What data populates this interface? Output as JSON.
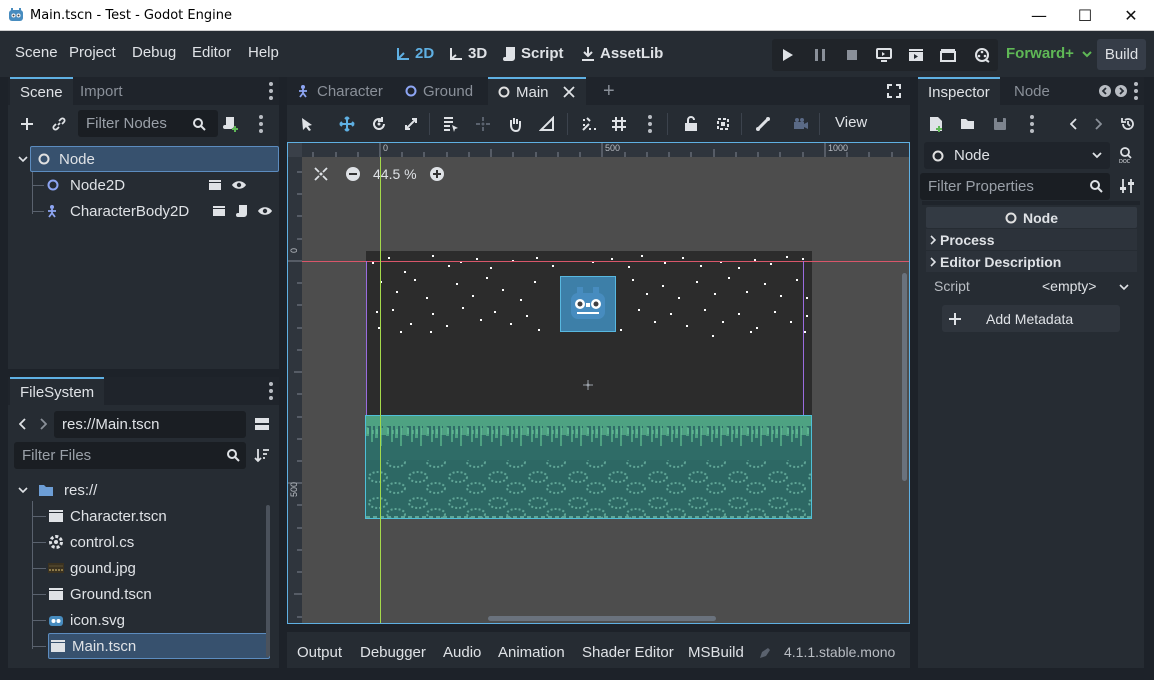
{
  "window": {
    "title": "Main.tscn - Test - Godot Engine",
    "minimize": "—",
    "maximize": "☐",
    "close": "✕"
  },
  "menubar": {
    "menus": [
      "Scene",
      "Project",
      "Debug",
      "Editor",
      "Help"
    ],
    "workspaces": [
      "2D",
      "3D",
      "Script",
      "AssetLib"
    ],
    "renderer": "Forward+",
    "build": "Build"
  },
  "scene_dock": {
    "tabs": [
      "Scene",
      "Import"
    ],
    "filter_placeholder": "Filter Nodes",
    "nodes": [
      {
        "name": "Node",
        "type": "Node",
        "selected": true
      },
      {
        "name": "Node2D",
        "type": "Node2D",
        "selected": false
      },
      {
        "name": "CharacterBody2D",
        "type": "CharacterBody2D",
        "selected": false
      }
    ]
  },
  "filesystem_dock": {
    "tab": "FileSystem",
    "path": "res://Main.tscn",
    "filter_placeholder": "Filter Files",
    "root": "res://",
    "files": [
      {
        "name": "Character.tscn",
        "icon": "scene-icon"
      },
      {
        "name": "control.cs",
        "icon": "csharp-icon"
      },
      {
        "name": "gound.jpg",
        "icon": "image-icon"
      },
      {
        "name": "Ground.tscn",
        "icon": "scene-icon"
      },
      {
        "name": "icon.svg",
        "icon": "godot-icon"
      },
      {
        "name": "Main.tscn",
        "icon": "scene-icon",
        "selected": true
      }
    ]
  },
  "editor_tabs": {
    "tabs": [
      {
        "label": "Character",
        "active": false
      },
      {
        "label": "Ground",
        "active": false
      },
      {
        "label": "Main",
        "active": true
      }
    ],
    "add": "+"
  },
  "canvas_toolbar": {
    "view": "View"
  },
  "viewport": {
    "zoom": "44.5 %",
    "ruler_top": [
      "0",
      "500",
      "1000"
    ],
    "ruler_left": [
      "0",
      "500"
    ]
  },
  "bottom_panel": {
    "tabs": [
      "Output",
      "Debugger",
      "Audio",
      "Animation",
      "Shader Editor",
      "MSBuild"
    ],
    "version": "4.1.1.stable.mono"
  },
  "inspector": {
    "tabs": [
      "Inspector",
      "Node"
    ],
    "node_selector": "Node",
    "filter_placeholder": "Filter Properties",
    "class_header": "Node",
    "sections": [
      "Process",
      "Editor Description"
    ],
    "script_label": "Script",
    "script_value": "<empty>",
    "add_metadata": "Add Metadata"
  },
  "colors": {
    "accent": "#5fb0e3",
    "renderer_green": "#5fb856",
    "panel_bg": "#262c33",
    "base_bg": "#1d2229"
  }
}
